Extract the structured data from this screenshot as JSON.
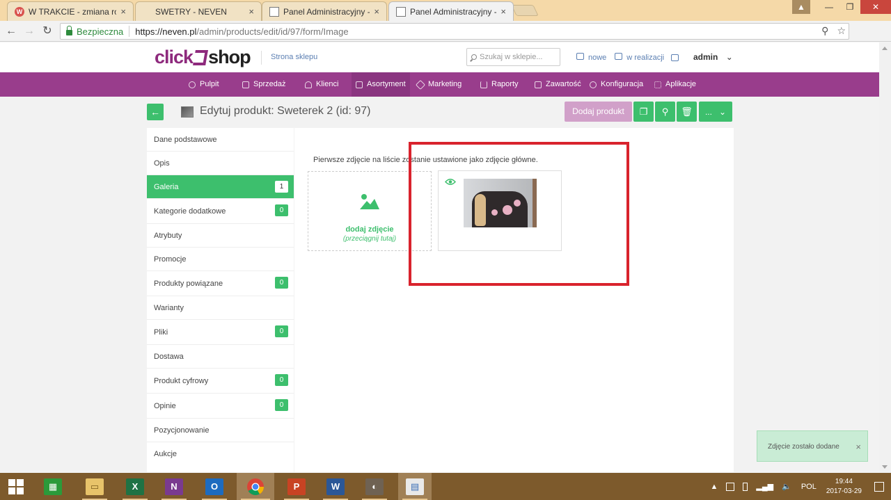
{
  "browser": {
    "tabs": [
      {
        "label": "W TRAKCIE - zmiana roz",
        "favicon": "ring-logo-icon"
      },
      {
        "label": "SWETRY - NEVEN",
        "favicon": "page-icon"
      },
      {
        "label": "Panel Administracyjny - A",
        "favicon": "page-icon"
      },
      {
        "label": "Panel Administracyjny - P",
        "favicon": "page-icon"
      }
    ],
    "secure_label": "Bezpieczna",
    "url_host": "https://neven.pl",
    "url_path": "/admin/products/edit/id/97/form/Image"
  },
  "header": {
    "logo_click": "click",
    "logo_shop": "shop",
    "store_link": "Strona sklepu",
    "search_placeholder": "Szukaj w sklepie...",
    "link_new": "nowe",
    "link_in_progress": "w realizacji",
    "user": "admin"
  },
  "nav": {
    "items": [
      "Pulpit",
      "Sprzedaż",
      "Klienci",
      "Asortyment",
      "Marketing",
      "Raporty",
      "Zawartość",
      "Konfiguracja",
      "Aplikacje"
    ]
  },
  "page": {
    "title": "Edytuj produkt: Sweterek 2 (id: 97)",
    "add_product": "Dodaj produkt",
    "more": "..."
  },
  "sidebar": {
    "items": [
      {
        "label": "Dane podstawowe",
        "badge": null
      },
      {
        "label": "Opis",
        "badge": null
      },
      {
        "label": "Galeria",
        "badge": "1"
      },
      {
        "label": "Kategorie dodatkowe",
        "badge": "0"
      },
      {
        "label": "Atrybuty",
        "badge": null
      },
      {
        "label": "Promocje",
        "badge": null
      },
      {
        "label": "Produkty powiązane",
        "badge": "0"
      },
      {
        "label": "Warianty",
        "badge": null
      },
      {
        "label": "Pliki",
        "badge": "0"
      },
      {
        "label": "Dostawa",
        "badge": null
      },
      {
        "label": "Produkt cyfrowy",
        "badge": "0"
      },
      {
        "label": "Opinie",
        "badge": "0"
      },
      {
        "label": "Pozycjonowanie",
        "badge": null
      },
      {
        "label": "Aukcje",
        "badge": null
      }
    ]
  },
  "gallery": {
    "hint": "Pierwsze zdjęcie na liście zostanie ustawione jako zdjęcie główne.",
    "add_label": "dodaj zdjęcie",
    "add_sub": "(przeciągnij tutaj)"
  },
  "toast": {
    "message": "Zdjęcie zostało dodane",
    "close": "×"
  },
  "taskbar": {
    "lang": "POL",
    "time": "19:44",
    "date": "2017-03-29"
  },
  "colors": {
    "brand_purple": "#993d8c",
    "accent_green": "#3dbf6d",
    "highlight_red": "#d9232d"
  }
}
